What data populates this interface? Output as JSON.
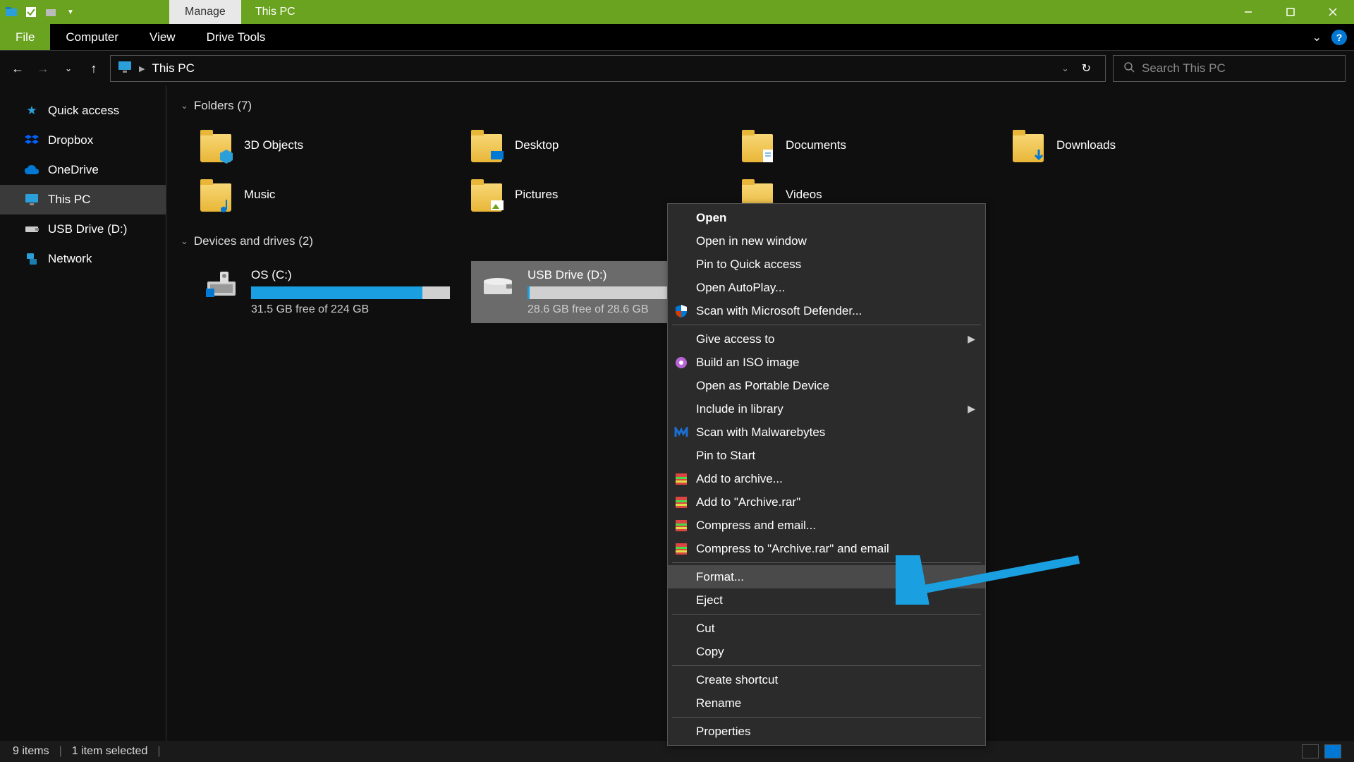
{
  "titlebar": {
    "manage_label": "Manage",
    "title": "This PC"
  },
  "ribbon": {
    "file": "File",
    "tabs": [
      "Computer",
      "View",
      "Drive Tools"
    ]
  },
  "address": {
    "location": "This PC",
    "search_placeholder": "Search This PC"
  },
  "sidebar": {
    "items": [
      {
        "label": "Quick access"
      },
      {
        "label": "Dropbox"
      },
      {
        "label": "OneDrive"
      },
      {
        "label": "This PC"
      },
      {
        "label": "USB Drive (D:)"
      },
      {
        "label": "Network"
      }
    ]
  },
  "sections": {
    "folders_header": "Folders (7)",
    "drives_header": "Devices and drives (2)"
  },
  "folders": [
    {
      "label": "3D Objects"
    },
    {
      "label": "Desktop"
    },
    {
      "label": "Documents"
    },
    {
      "label": "Downloads"
    },
    {
      "label": "Music"
    },
    {
      "label": "Pictures"
    },
    {
      "label": "Videos"
    }
  ],
  "drives": [
    {
      "name": "OS (C:)",
      "free_text": "31.5 GB free of 224 GB",
      "fill_pct": 86
    },
    {
      "name": "USB Drive (D:)",
      "free_text": "28.6 GB free of 28.6 GB",
      "fill_pct": 1
    }
  ],
  "context_menu": {
    "groups": [
      [
        {
          "label": "Open",
          "bold": true
        },
        {
          "label": "Open in new window"
        },
        {
          "label": "Pin to Quick access"
        },
        {
          "label": "Open AutoPlay..."
        },
        {
          "label": "Scan with Microsoft Defender...",
          "icon": "shield"
        }
      ],
      [
        {
          "label": "Give access to",
          "submenu": true
        },
        {
          "label": "Build an ISO image",
          "icon": "iso"
        },
        {
          "label": "Open as Portable Device"
        },
        {
          "label": "Include in library",
          "submenu": true
        },
        {
          "label": "Scan with Malwarebytes",
          "icon": "malwarebytes"
        },
        {
          "label": "Pin to Start"
        },
        {
          "label": "Add to archive...",
          "icon": "winrar"
        },
        {
          "label": "Add to \"Archive.rar\"",
          "icon": "winrar"
        },
        {
          "label": "Compress and email...",
          "icon": "winrar"
        },
        {
          "label": "Compress to \"Archive.rar\" and email",
          "icon": "winrar"
        }
      ],
      [
        {
          "label": "Format...",
          "hover": true
        },
        {
          "label": "Eject"
        }
      ],
      [
        {
          "label": "Cut"
        },
        {
          "label": "Copy"
        }
      ],
      [
        {
          "label": "Create shortcut"
        },
        {
          "label": "Rename"
        }
      ],
      [
        {
          "label": "Properties"
        }
      ]
    ]
  },
  "statusbar": {
    "items_text": "9 items",
    "selected_text": "1 item selected"
  }
}
